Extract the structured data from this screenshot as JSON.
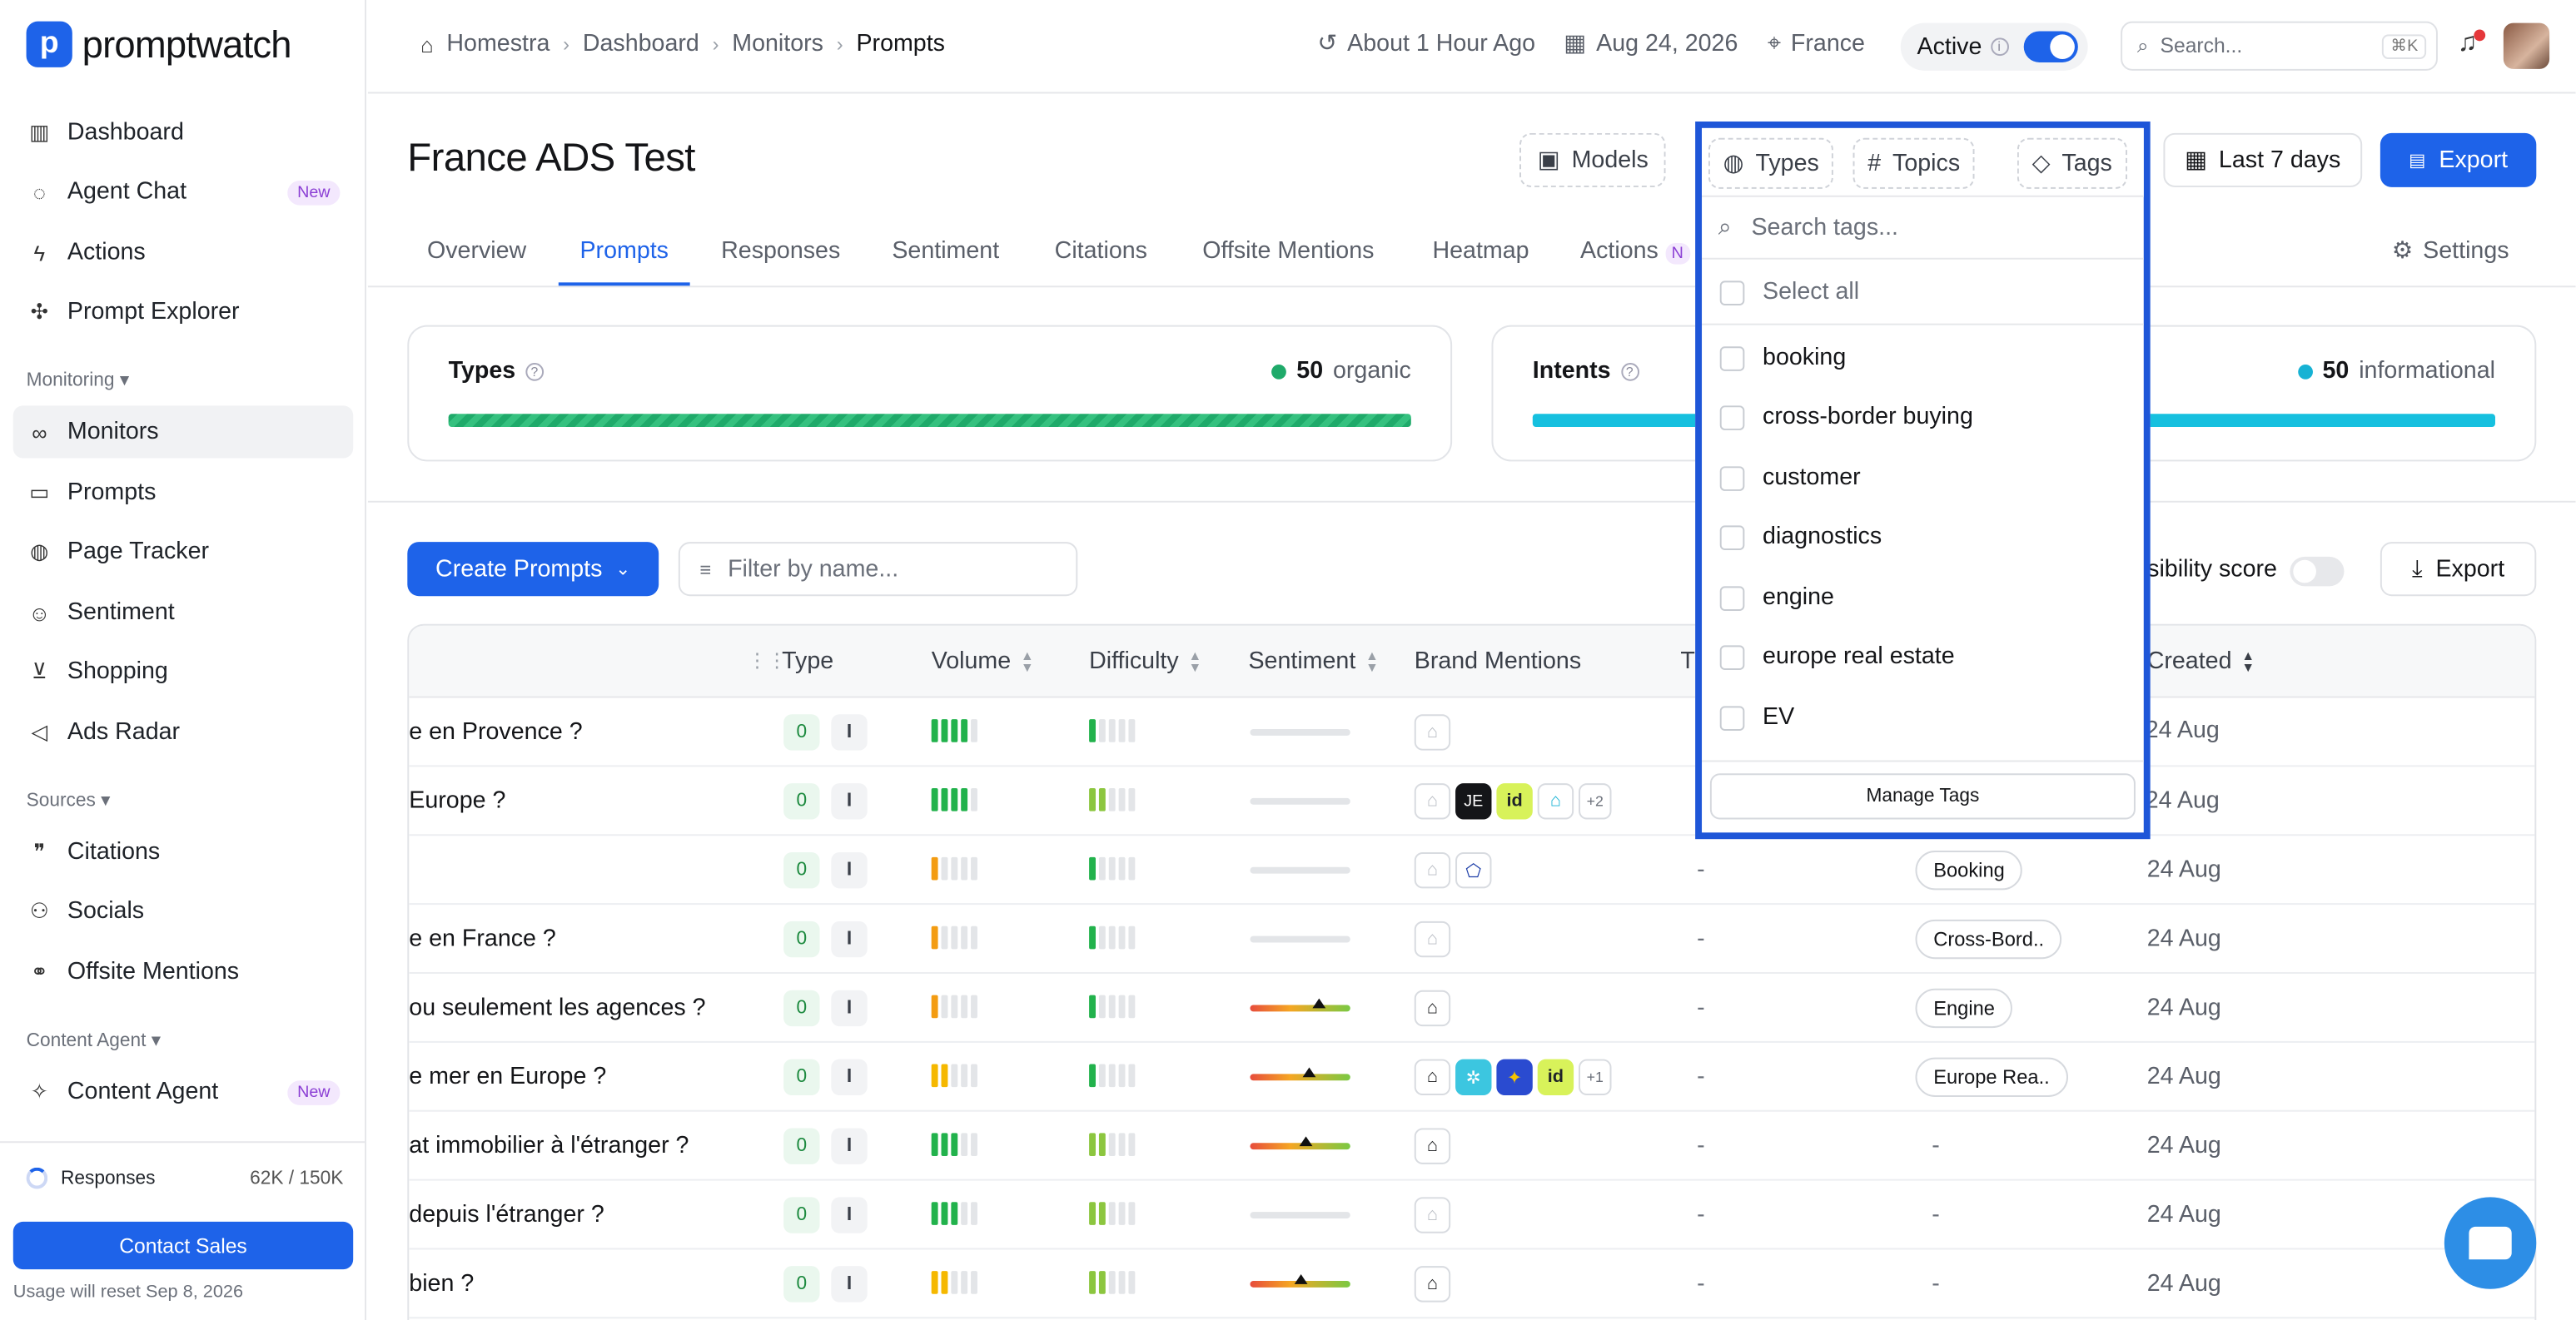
{
  "app": {
    "logo_text": "promptwatch",
    "logo_mark": "p"
  },
  "sidebar": {
    "items": [
      {
        "label": "Dashboard",
        "icon": "bar-chart-icon"
      },
      {
        "label": "Agent Chat",
        "icon": "chat-icon",
        "badge": "New"
      },
      {
        "label": "Actions",
        "icon": "bolt-icon"
      },
      {
        "label": "Prompt Explorer",
        "icon": "explorer-icon"
      }
    ],
    "monitoring_label": "Monitoring",
    "monitoring_items": [
      {
        "label": "Monitors",
        "icon": "binoculars-icon"
      },
      {
        "label": "Prompts",
        "icon": "prompt-icon"
      },
      {
        "label": "Page Tracker",
        "icon": "tracker-icon"
      },
      {
        "label": "Sentiment",
        "icon": "sentiment-icon"
      },
      {
        "label": "Shopping",
        "icon": "cart-icon"
      },
      {
        "label": "Ads Radar",
        "icon": "megaphone-icon"
      }
    ],
    "sources_label": "Sources",
    "sources_items": [
      {
        "label": "Citations",
        "icon": "quote-icon"
      },
      {
        "label": "Socials",
        "icon": "people-icon"
      },
      {
        "label": "Offsite Mentions",
        "icon": "mentions-icon"
      }
    ],
    "content_label": "Content Agent",
    "content_items": [
      {
        "label": "Content Agent",
        "icon": "sparkle-icon",
        "badge": "New"
      }
    ],
    "usage_label": "Responses",
    "usage_count": "62K / 150K",
    "contact_label": "Contact Sales",
    "reset_text": "Usage will reset Sep 8, 2026"
  },
  "topbar": {
    "breadcrumbs": [
      "Homestra",
      "Dashboard",
      "Monitors",
      "Prompts"
    ],
    "updated": "About 1 Hour Ago",
    "date": "Aug 24, 2026",
    "location": "France",
    "status": "Active",
    "search_placeholder": "Search...",
    "shortcut": "⌘K"
  },
  "page": {
    "title": "France ADS Test",
    "filters": {
      "models": "Models",
      "types": "Types",
      "topics": "Topics",
      "tags": "Tags"
    },
    "range": "Last 7 days",
    "export": "Export",
    "tabs": [
      "Overview",
      "Prompts",
      "Responses",
      "Sentiment",
      "Citations",
      "Offsite Mentions",
      "Heatmap",
      "Actions"
    ],
    "actions_badge": "N",
    "settings": "Settings"
  },
  "cards": {
    "types": {
      "title": "Types",
      "count": "50",
      "label": "organic",
      "color": "#1faa6a"
    },
    "intents": {
      "title": "Intents",
      "count": "50",
      "label": "informational",
      "color": "#16b2d4"
    }
  },
  "toolbar": {
    "create": "Create Prompts",
    "filter_placeholder": "Filter by name...",
    "visibility": "isibility score",
    "export": "Export"
  },
  "table": {
    "headers": {
      "type": "Type",
      "volume": "Volume",
      "difficulty": "Difficulty",
      "sentiment": "Sentiment",
      "brand": "Brand Mentions",
      "t": "T",
      "created": "Created"
    },
    "rows": [
      {
        "prompt": "e en Provence ?",
        "o": "0",
        "i": "I",
        "tag": "",
        "created": "24 Aug",
        "topic": ""
      },
      {
        "prompt": "Europe ?",
        "o": "0",
        "i": "I",
        "tag": "",
        "created": "24 Aug",
        "topic": "",
        "more": "+2"
      },
      {
        "prompt": "",
        "o": "0",
        "i": "I",
        "tag": "Booking",
        "created": "24 Aug",
        "topic": "-"
      },
      {
        "prompt": "e en France ?",
        "o": "0",
        "i": "I",
        "tag": "Cross-Bord..",
        "created": "24 Aug",
        "topic": "-"
      },
      {
        "prompt": "ou seulement les agences ?",
        "o": "0",
        "i": "I",
        "tag": "Engine",
        "created": "24 Aug",
        "topic": "-"
      },
      {
        "prompt": "e mer en Europe ?",
        "o": "0",
        "i": "I",
        "tag": "Europe Rea..",
        "created": "24 Aug",
        "topic": "-",
        "more": "+1"
      },
      {
        "prompt": "at immobilier à l'étranger ?",
        "o": "0",
        "i": "I",
        "tag": "-",
        "created": "24 Aug",
        "topic": "-"
      },
      {
        "prompt": "depuis l'étranger ?",
        "o": "0",
        "i": "I",
        "tag": "-",
        "created": "24 Aug",
        "topic": "-"
      },
      {
        "prompt": "bien ?",
        "o": "0",
        "i": "I",
        "tag": "-",
        "created": "24 Aug",
        "topic": "-"
      }
    ]
  },
  "tags_dropdown": {
    "search_placeholder": "Search tags...",
    "select_all": "Select all",
    "options": [
      "booking",
      "cross-border buying",
      "customer",
      "diagnostics",
      "engine",
      "europe real estate",
      "EV"
    ],
    "manage": "Manage Tags"
  },
  "brand_logos": {
    "je": "JE",
    "id": "id"
  }
}
